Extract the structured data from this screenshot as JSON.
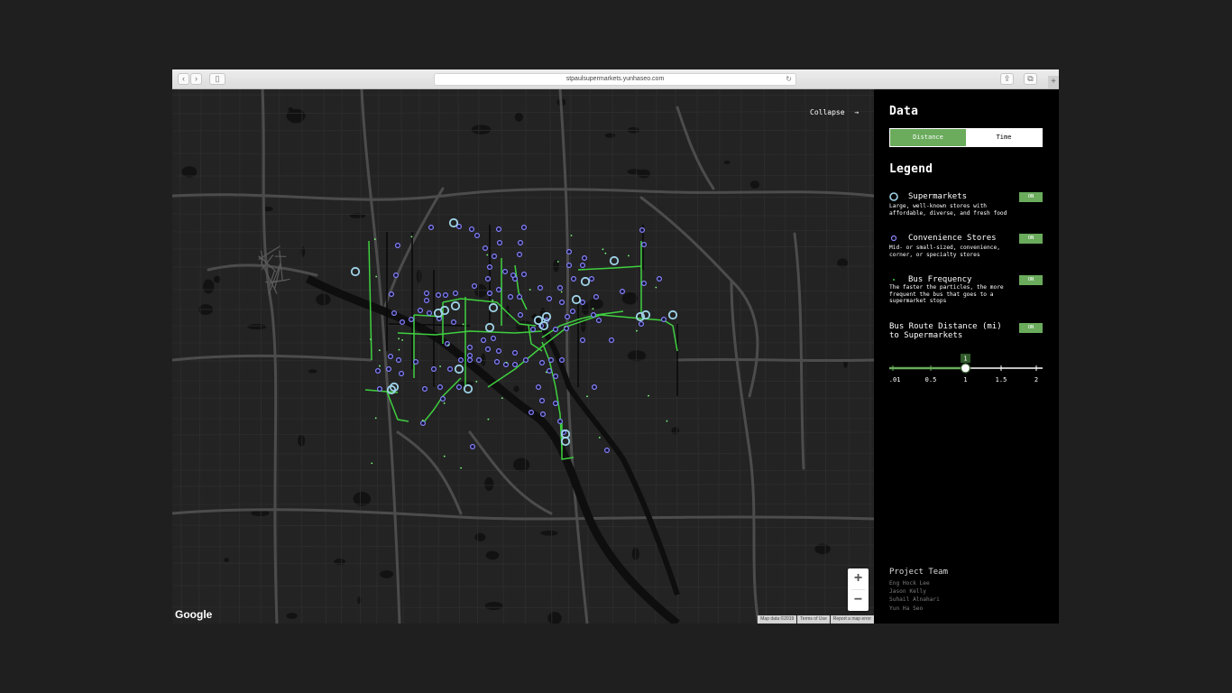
{
  "browser": {
    "url": "stpaulsupermarkets.yunhaseo.com"
  },
  "map": {
    "collapse_label": "Collapse",
    "arrow": "→",
    "zoom_in": "+",
    "zoom_out": "−",
    "google_logo": "Google",
    "footer": [
      "Map data ©2019",
      "Terms of Use",
      "Report a map error"
    ]
  },
  "panel": {
    "data_title": "Data",
    "toggle": {
      "distance": "Distance",
      "time": "Time",
      "selected": "Distance"
    },
    "legend_title": "Legend",
    "items": [
      {
        "title": "Supermarkets",
        "desc": "Large, well-known stores with affordable, diverse, and fresh food",
        "toggle": "ON"
      },
      {
        "title": "Convenience Stores",
        "desc": "Mid- or small-sized, convenience, corner, or specialty stores",
        "toggle": "ON"
      },
      {
        "title": "Bus Frequency",
        "desc": "The faster the particles, the more frequent the bus that goes to a supermarket stops",
        "toggle": "ON"
      },
      {
        "title": "Bus Route Distance (mi) to Supermarkets",
        "toggle": "ON"
      }
    ],
    "slider": {
      "value": "1",
      "ticks": [
        "0.01",
        "0.5",
        "1",
        "1.5",
        "2"
      ]
    },
    "team_title": "Project Team",
    "team": [
      "Eng Hock Lee",
      "Jason Kelly",
      "Suhail Alnahari",
      "Yun Ha Seo"
    ]
  },
  "colors": {
    "accent": "#6aab5c",
    "supermarket": "#9fd3e8",
    "convenience": "#8a86ff",
    "bus_route": "#3fd03f",
    "map_bg": "#232323"
  }
}
